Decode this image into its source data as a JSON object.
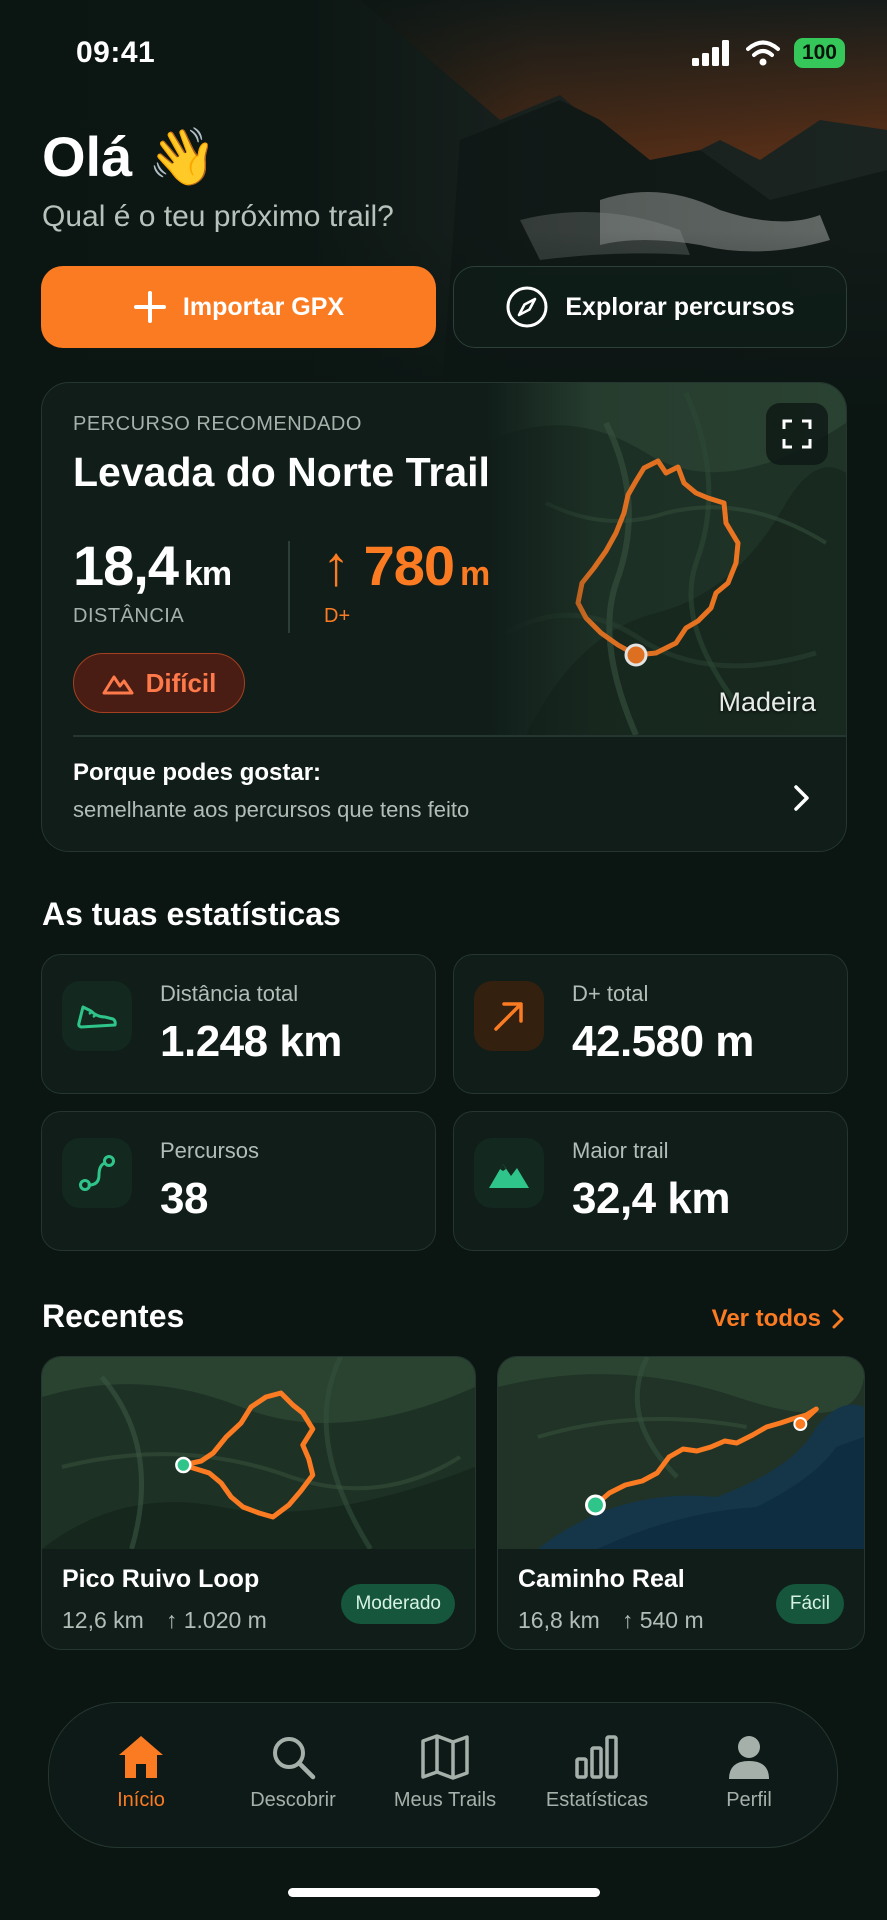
{
  "status": {
    "time": "09:41",
    "battery": "100"
  },
  "header": {
    "greeting": "Olá 👋",
    "subtitle": "Qual é o teu próximo trail?"
  },
  "actions": {
    "import_label": "Importar GPX",
    "explore_label": "Explorar percursos"
  },
  "recommended": {
    "eyebrow": "PERCURSO RECOMENDADO",
    "title": "Levada do Norte Trail",
    "distance_value": "18,4",
    "distance_unit": "km",
    "distance_label": "DISTÂNCIA",
    "elevation_value": "780",
    "elevation_unit": "m",
    "elevation_label": "D+",
    "difficulty": "Difícil",
    "map_place": "Madeira",
    "why_title": "Porque podes gostar:",
    "why_text": "semelhante aos percursos que tens feito"
  },
  "stats": {
    "title": "As tuas estatísticas",
    "items": [
      {
        "label": "Distância total",
        "value": "1.248 km",
        "icon": "shoe-icon"
      },
      {
        "label": "D+ total",
        "value": "42.580 m",
        "icon": "arrow-up-right-icon"
      },
      {
        "label": "Percursos",
        "value": "38",
        "icon": "route-icon"
      },
      {
        "label": "Maior trail",
        "value": "32,4 km",
        "icon": "mountain-icon"
      }
    ]
  },
  "recent": {
    "title": "Recentes",
    "see_all": "Ver todos",
    "items": [
      {
        "name": "Pico Ruivo Loop",
        "distance": "12,6 km",
        "elevation": "↑ 1.020 m",
        "difficulty": "Moderado"
      },
      {
        "name": "Caminho Real",
        "distance": "16,8 km",
        "elevation": "↑ 540 m",
        "difficulty": "Fácil"
      }
    ]
  },
  "tabs": [
    {
      "label": "Início",
      "icon": "home-icon",
      "active": true
    },
    {
      "label": "Descobrir",
      "icon": "search-icon"
    },
    {
      "label": "Meus Trails",
      "icon": "map-icon"
    },
    {
      "label": "Estatísticas",
      "icon": "bar-chart-icon"
    },
    {
      "label": "Perfil",
      "icon": "user-icon"
    }
  ],
  "colors": {
    "accent": "#fb7b22",
    "background": "#0b1512",
    "card": "#101d19",
    "success": "#16563c",
    "danger": "#ff7a4a"
  }
}
